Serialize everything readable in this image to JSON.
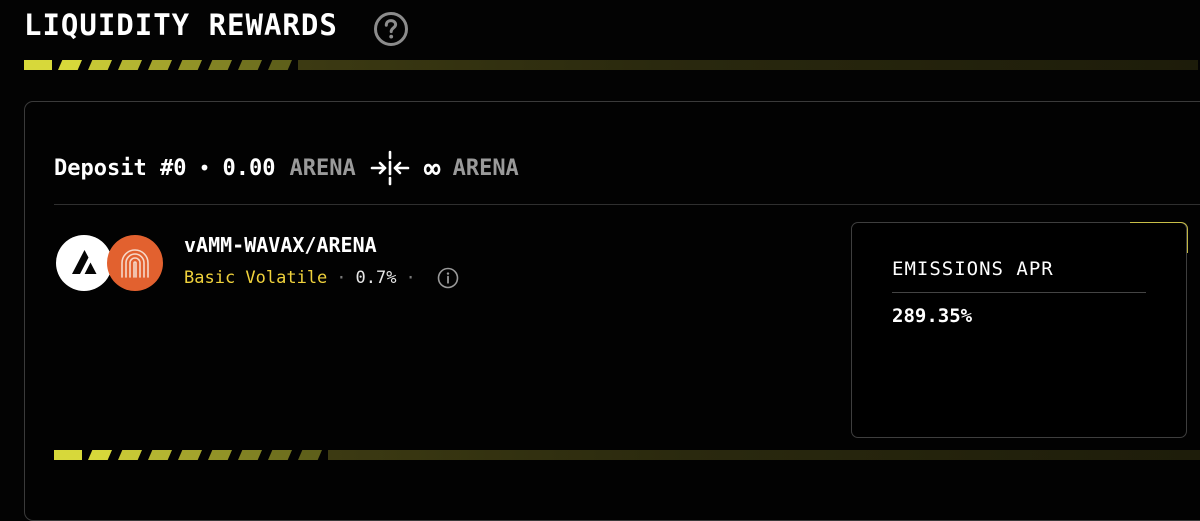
{
  "header": {
    "title": "LIQUIDITY REWARDS",
    "help_icon": "question-circle-icon"
  },
  "deposit": {
    "label": "Deposit #0",
    "separator": "•",
    "min_amount": "0.00",
    "min_token": "ARENA",
    "range_icon": "arrows-converge-icon",
    "max_amount": "∞",
    "max_token": "ARENA"
  },
  "pool": {
    "name": "vAMM-WAVAX/ARENA",
    "type": "Basic Volatile",
    "fee": "0.7%",
    "meta_separator": "·",
    "token_a_icon": "avalanche-logo-icon",
    "token_b_icon": "arena-logo-icon",
    "info_icon": "info-circle-icon"
  },
  "rewards": {
    "label": "EMISSIONS APR",
    "value": "289.35%"
  },
  "colors": {
    "accent_yellow": "#d7d83a",
    "type_yellow": "#f0d23c",
    "token_b_orange": "#e2612f"
  }
}
